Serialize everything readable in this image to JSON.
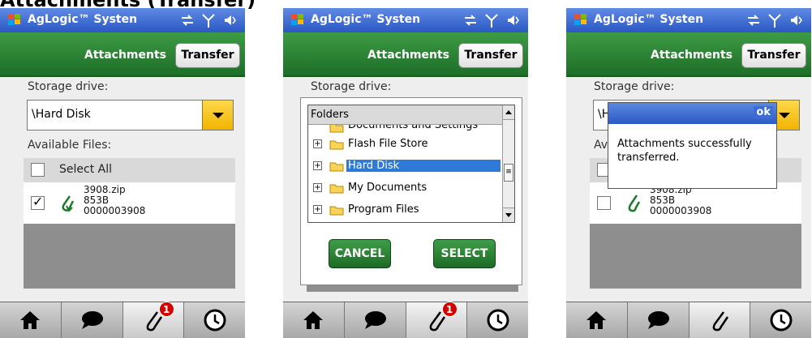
{
  "page_title": "Attachments (Transfer)",
  "colors": {
    "header_green": "#2e8a37",
    "status_blue": "#3a66cc",
    "dropdown_yellow": "#f6c400",
    "badge_red": "#d40000"
  },
  "status_bar": {
    "app_title": "AgLogic™ Systen"
  },
  "header": {
    "tab_label": "Attachments",
    "transfer_label": "Transfer"
  },
  "form": {
    "storage_label": "Storage drive:",
    "storage_value": "\\Hard Disk",
    "storage_value_short": "\\H",
    "available_label": "Available Files:",
    "available_label_short": "Ava",
    "select_all_label": "Select All"
  },
  "file": {
    "name": "3908.zip",
    "size": "853B",
    "id": "0000003908"
  },
  "nav": {
    "items": [
      "home-icon",
      "chat-icon",
      "attachment-icon",
      "clock-icon"
    ],
    "badge_count": "1"
  },
  "folder_dialog": {
    "header": "Folders",
    "partial_item": "Documents and Settings",
    "items": [
      "Flash File Store",
      "Hard Disk",
      "My Documents",
      "Program Files"
    ],
    "selected": "Hard Disk",
    "cancel_label": "CANCEL",
    "select_label": "SELECT"
  },
  "message_box": {
    "ok_label": "ok",
    "text": "Attachments successfully transferred."
  }
}
